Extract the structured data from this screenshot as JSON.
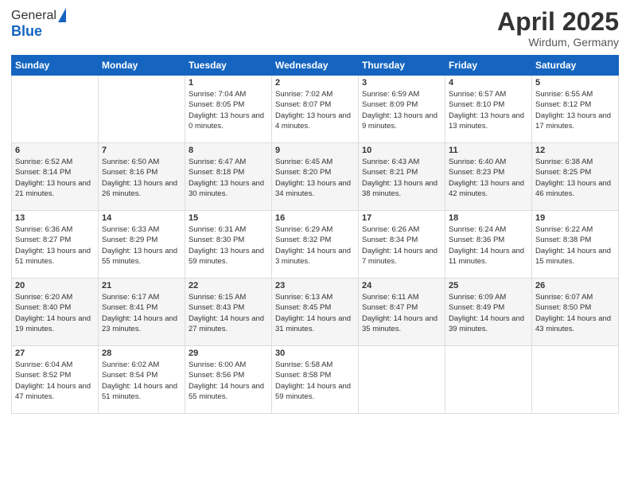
{
  "header": {
    "logo_general": "General",
    "logo_blue": "Blue",
    "title": "April 2025",
    "location": "Wirdum, Germany"
  },
  "days_of_week": [
    "Sunday",
    "Monday",
    "Tuesday",
    "Wednesday",
    "Thursday",
    "Friday",
    "Saturday"
  ],
  "weeks": [
    [
      {
        "day": "",
        "details": ""
      },
      {
        "day": "",
        "details": ""
      },
      {
        "day": "1",
        "details": "Sunrise: 7:04 AM\nSunset: 8:05 PM\nDaylight: 13 hours and 0 minutes."
      },
      {
        "day": "2",
        "details": "Sunrise: 7:02 AM\nSunset: 8:07 PM\nDaylight: 13 hours and 4 minutes."
      },
      {
        "day": "3",
        "details": "Sunrise: 6:59 AM\nSunset: 8:09 PM\nDaylight: 13 hours and 9 minutes."
      },
      {
        "day": "4",
        "details": "Sunrise: 6:57 AM\nSunset: 8:10 PM\nDaylight: 13 hours and 13 minutes."
      },
      {
        "day": "5",
        "details": "Sunrise: 6:55 AM\nSunset: 8:12 PM\nDaylight: 13 hours and 17 minutes."
      }
    ],
    [
      {
        "day": "6",
        "details": "Sunrise: 6:52 AM\nSunset: 8:14 PM\nDaylight: 13 hours and 21 minutes."
      },
      {
        "day": "7",
        "details": "Sunrise: 6:50 AM\nSunset: 8:16 PM\nDaylight: 13 hours and 26 minutes."
      },
      {
        "day": "8",
        "details": "Sunrise: 6:47 AM\nSunset: 8:18 PM\nDaylight: 13 hours and 30 minutes."
      },
      {
        "day": "9",
        "details": "Sunrise: 6:45 AM\nSunset: 8:20 PM\nDaylight: 13 hours and 34 minutes."
      },
      {
        "day": "10",
        "details": "Sunrise: 6:43 AM\nSunset: 8:21 PM\nDaylight: 13 hours and 38 minutes."
      },
      {
        "day": "11",
        "details": "Sunrise: 6:40 AM\nSunset: 8:23 PM\nDaylight: 13 hours and 42 minutes."
      },
      {
        "day": "12",
        "details": "Sunrise: 6:38 AM\nSunset: 8:25 PM\nDaylight: 13 hours and 46 minutes."
      }
    ],
    [
      {
        "day": "13",
        "details": "Sunrise: 6:36 AM\nSunset: 8:27 PM\nDaylight: 13 hours and 51 minutes."
      },
      {
        "day": "14",
        "details": "Sunrise: 6:33 AM\nSunset: 8:29 PM\nDaylight: 13 hours and 55 minutes."
      },
      {
        "day": "15",
        "details": "Sunrise: 6:31 AM\nSunset: 8:30 PM\nDaylight: 13 hours and 59 minutes."
      },
      {
        "day": "16",
        "details": "Sunrise: 6:29 AM\nSunset: 8:32 PM\nDaylight: 14 hours and 3 minutes."
      },
      {
        "day": "17",
        "details": "Sunrise: 6:26 AM\nSunset: 8:34 PM\nDaylight: 14 hours and 7 minutes."
      },
      {
        "day": "18",
        "details": "Sunrise: 6:24 AM\nSunset: 8:36 PM\nDaylight: 14 hours and 11 minutes."
      },
      {
        "day": "19",
        "details": "Sunrise: 6:22 AM\nSunset: 8:38 PM\nDaylight: 14 hours and 15 minutes."
      }
    ],
    [
      {
        "day": "20",
        "details": "Sunrise: 6:20 AM\nSunset: 8:40 PM\nDaylight: 14 hours and 19 minutes."
      },
      {
        "day": "21",
        "details": "Sunrise: 6:17 AM\nSunset: 8:41 PM\nDaylight: 14 hours and 23 minutes."
      },
      {
        "day": "22",
        "details": "Sunrise: 6:15 AM\nSunset: 8:43 PM\nDaylight: 14 hours and 27 minutes."
      },
      {
        "day": "23",
        "details": "Sunrise: 6:13 AM\nSunset: 8:45 PM\nDaylight: 14 hours and 31 minutes."
      },
      {
        "day": "24",
        "details": "Sunrise: 6:11 AM\nSunset: 8:47 PM\nDaylight: 14 hours and 35 minutes."
      },
      {
        "day": "25",
        "details": "Sunrise: 6:09 AM\nSunset: 8:49 PM\nDaylight: 14 hours and 39 minutes."
      },
      {
        "day": "26",
        "details": "Sunrise: 6:07 AM\nSunset: 8:50 PM\nDaylight: 14 hours and 43 minutes."
      }
    ],
    [
      {
        "day": "27",
        "details": "Sunrise: 6:04 AM\nSunset: 8:52 PM\nDaylight: 14 hours and 47 minutes."
      },
      {
        "day": "28",
        "details": "Sunrise: 6:02 AM\nSunset: 8:54 PM\nDaylight: 14 hours and 51 minutes."
      },
      {
        "day": "29",
        "details": "Sunrise: 6:00 AM\nSunset: 8:56 PM\nDaylight: 14 hours and 55 minutes."
      },
      {
        "day": "30",
        "details": "Sunrise: 5:58 AM\nSunset: 8:58 PM\nDaylight: 14 hours and 59 minutes."
      },
      {
        "day": "",
        "details": ""
      },
      {
        "day": "",
        "details": ""
      },
      {
        "day": "",
        "details": ""
      }
    ]
  ]
}
